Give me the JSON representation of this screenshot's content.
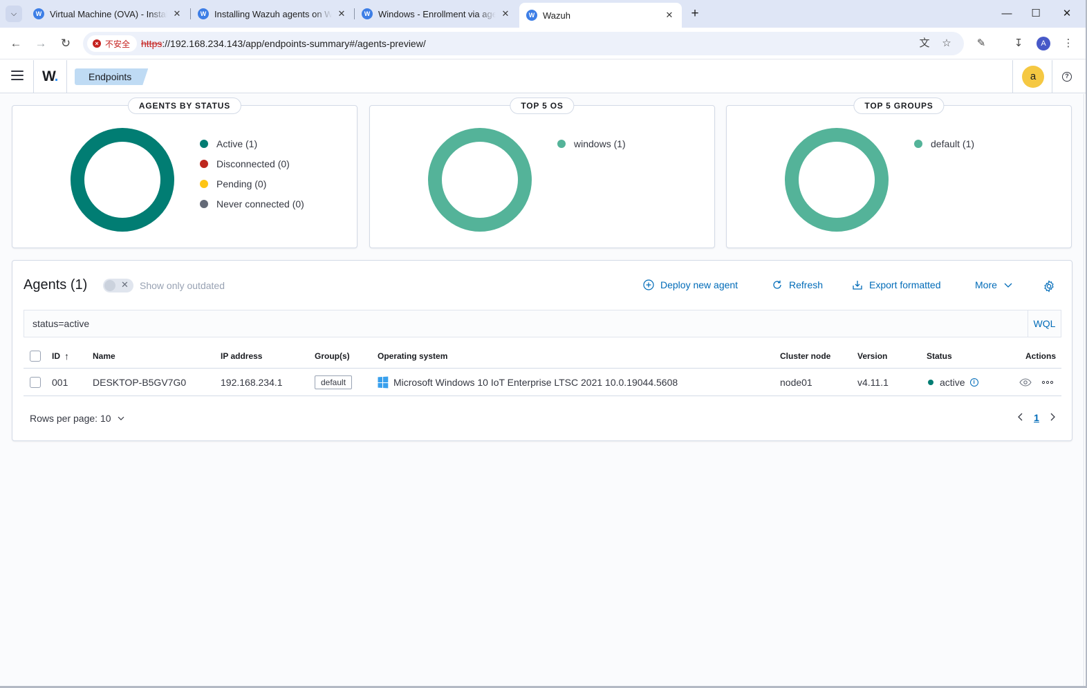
{
  "browser": {
    "tabs": [
      {
        "title": "Virtual Machine (OVA) - Installation",
        "favicon": "W"
      },
      {
        "title": "Installing Wazuh agents on Windows",
        "favicon": "W"
      },
      {
        "title": "Windows - Enrollment via agent",
        "favicon": "W"
      },
      {
        "title": "Wazuh",
        "favicon": "W"
      }
    ],
    "security_label": "不安全",
    "url_scheme": "https",
    "url_rest": "://192.168.234.143/app/endpoints-summary#/agents-preview/",
    "profile_initial": "A"
  },
  "app": {
    "logo": "W",
    "breadcrumb": "Endpoints",
    "avatar_initial": "a"
  },
  "cards": [
    {
      "title": "AGENTS BY STATUS",
      "ring_color": "#017d73",
      "legend": [
        {
          "label": "Active (1)",
          "color": "#017d73"
        },
        {
          "label": "Disconnected (0)",
          "color": "#bd271e"
        },
        {
          "label": "Pending (0)",
          "color": "#fec514"
        },
        {
          "label": "Never connected (0)",
          "color": "#646a77"
        }
      ]
    },
    {
      "title": "TOP 5 OS",
      "ring_color": "#54b399",
      "legend": [
        {
          "label": "windows (1)",
          "color": "#54b399"
        }
      ]
    },
    {
      "title": "TOP 5 GROUPS",
      "ring_color": "#54b399",
      "legend": [
        {
          "label": "default (1)",
          "color": "#54b399"
        }
      ]
    }
  ],
  "agents": {
    "title": "Agents (1)",
    "outdated_label": "Show only outdated",
    "actions": {
      "deploy": "Deploy new agent",
      "refresh": "Refresh",
      "export": "Export formatted",
      "more": "More"
    },
    "search_value": "status=active",
    "wql": "WQL",
    "columns": {
      "id": "ID",
      "name": "Name",
      "ip": "IP address",
      "groups": "Group(s)",
      "os": "Operating system",
      "node": "Cluster node",
      "version": "Version",
      "status": "Status",
      "actions": "Actions"
    },
    "rows": [
      {
        "id": "001",
        "name": "DESKTOP-B5GV7G0",
        "ip": "192.168.234.1",
        "group": "default",
        "os": "Microsoft Windows 10 IoT Enterprise LTSC 2021 10.0.19044.5608",
        "node": "node01",
        "version": "v4.11.1",
        "status": "active"
      }
    ],
    "rows_per_page": "Rows per page: 10",
    "current_page": "1"
  }
}
